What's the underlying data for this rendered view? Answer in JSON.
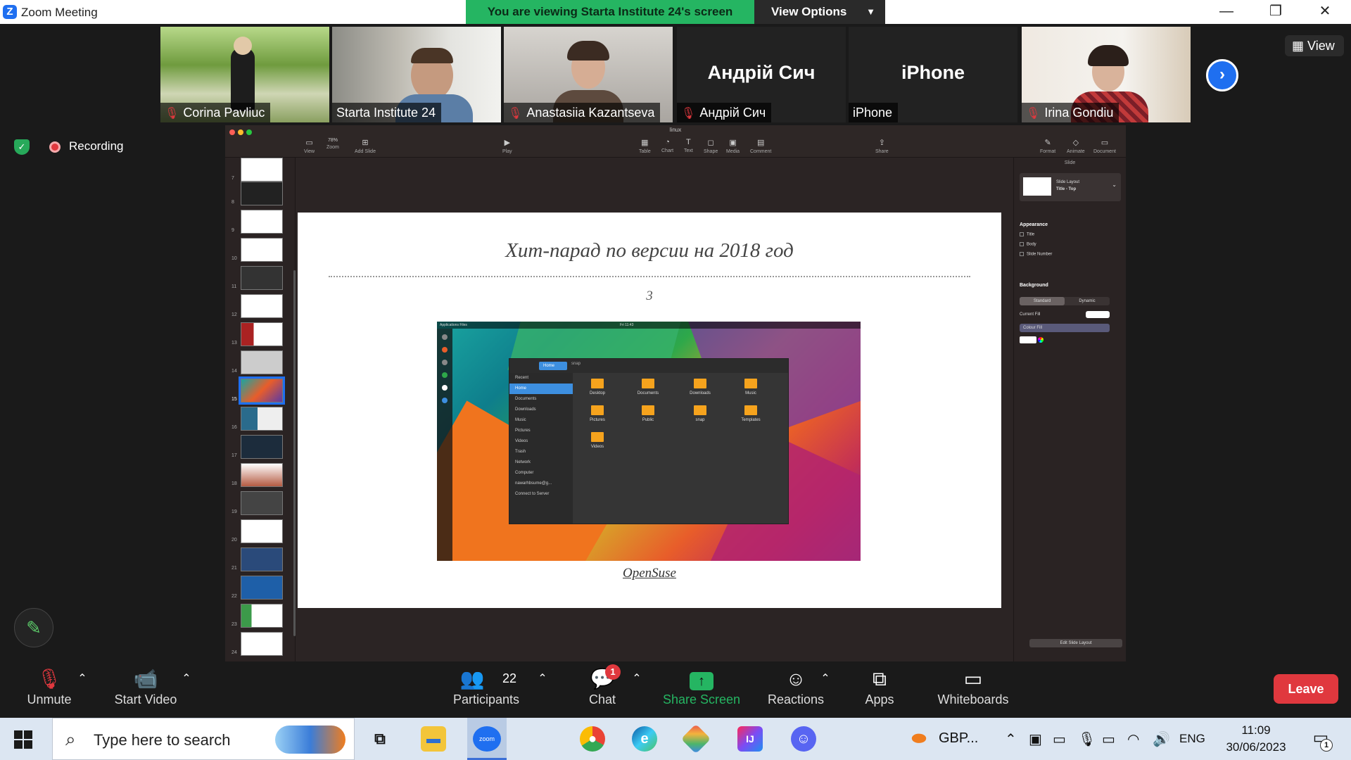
{
  "window": {
    "title": "Zoom Meeting",
    "minimize": "—",
    "restore": "❐",
    "close": "✕"
  },
  "banner": {
    "viewing_text": "You are viewing Starta Institute 24's screen",
    "view_options": "View Options"
  },
  "gallery": {
    "view_label": "View",
    "participants": [
      {
        "name": "Corina Pavliuc",
        "muted": true,
        "video": true
      },
      {
        "name": "Starta Institute 24",
        "muted": false,
        "video": true,
        "active_speaker": true
      },
      {
        "name": "Anastasiia Kazantseva",
        "muted": true,
        "video": true
      },
      {
        "name": "Андрій Сич",
        "muted": true,
        "video": false,
        "big_name": "Андрій Сич"
      },
      {
        "name": "iPhone",
        "muted": false,
        "video": false,
        "big_name": "iPhone"
      },
      {
        "name": "Irina Gondiu",
        "muted": true,
        "video": true
      }
    ]
  },
  "status": {
    "recording": "Recording"
  },
  "keynote": {
    "document": "linux",
    "toolbar_left": [
      "View",
      "78%",
      "Zoom",
      "Add Slide"
    ],
    "toolbar_center": [
      "Play"
    ],
    "toolbar_insert": [
      "Table",
      "Chart",
      "Text",
      "Shape",
      "Media",
      "Comment"
    ],
    "toolbar_share": "Share",
    "toolbar_right": [
      "Format",
      "Animate",
      "Document"
    ],
    "slide_numbers": [
      "7",
      "8",
      "9",
      "10",
      "11",
      "12",
      "13",
      "14",
      "15",
      "16",
      "17",
      "18",
      "19",
      "20",
      "21",
      "22",
      "23",
      "24"
    ],
    "selected_slide": "15",
    "slide": {
      "title": "Хит-парад по версии на 2018 год",
      "number": "3",
      "caption": "OpenSuse"
    },
    "screenshot": {
      "topbar": "Applications   Files",
      "clock": "Fri 11:43",
      "home_crumb": "Home",
      "snap_crumb": "snap",
      "sidebar": [
        "Recent",
        "Home",
        "Documents",
        "Downloads",
        "Music",
        "Pictures",
        "Videos",
        "Trash",
        "Network",
        "Computer",
        "nawarhbsume@g...",
        "Connect to Server"
      ],
      "folders": [
        "Desktop",
        "Documents",
        "Downloads",
        "Music",
        "Pictures",
        "Public",
        "snap",
        "Templates",
        "Videos"
      ]
    },
    "inspector": {
      "header": "Slide",
      "layout_label": "Slide Layout",
      "layout_value": "Title - Top",
      "appearance": "Appearance",
      "checks": [
        "Title",
        "Body",
        "Slide Number"
      ],
      "background": "Background",
      "bg_options": [
        "Standard",
        "Dynamic"
      ],
      "current_fill": "Current Fill",
      "fill_type": "Colour Fill",
      "edit_layout": "Edit Slide Layout"
    }
  },
  "controls": {
    "unmute": "Unmute",
    "start_video": "Start Video",
    "participants": "Participants",
    "participant_count": "22",
    "chat": "Chat",
    "chat_badge": "1",
    "share_screen": "Share Screen",
    "reactions": "Reactions",
    "apps": "Apps",
    "whiteboards": "Whiteboards",
    "leave": "Leave"
  },
  "taskbar": {
    "search_placeholder": "Type here to search",
    "zoom_app": "zoom",
    "currency": "GBP...",
    "language": "ENG",
    "time": "11:09",
    "date": "30/06/2023",
    "notifications": "1"
  },
  "colors": {
    "zoom_blue": "#1f6ff0",
    "share_green": "#25b562",
    "leave_red": "#e0383e",
    "active_border": "#9ed35a"
  }
}
